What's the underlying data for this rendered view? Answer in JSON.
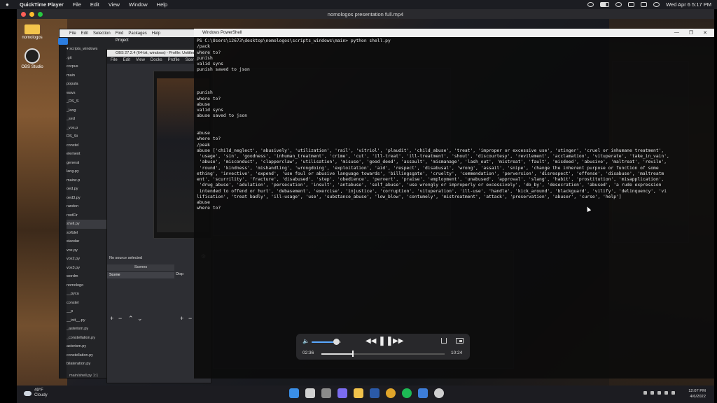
{
  "mac_menubar": {
    "app_name": "QuickTime Player",
    "menus": [
      "File",
      "Edit",
      "View",
      "Window",
      "Help"
    ],
    "datetime": "Wed Apr 6  5:17 PM"
  },
  "qt_window": {
    "title": "nomologos presentation full.mp4"
  },
  "desktop": {
    "icons": [
      {
        "label": "nomologos",
        "icon": "folder-icon"
      },
      {
        "label": "OBS Studio",
        "icon": "obs-icon"
      }
    ]
  },
  "ide": {
    "menus": [
      "File",
      "Edit",
      "Selection",
      "Find",
      "Packages",
      "Help"
    ],
    "project_label": "Project",
    "root": "scripts_windows",
    "tree": [
      "   .git",
      "   corpus",
      "  main",
      "     popula",
      "     wavs",
      "    _DS_S",
      "    _lang",
      "    _sed",
      "    _vox.p",
      "    DS_St",
      "    constel",
      "    element",
      "    general",
      "    lang.py",
      "    mainz.p",
      "    oed.py",
      "    oed3.py",
      "    randon",
      "    rootFir",
      "    shell.py",
      "    softdel",
      "    standar",
      "    vox.py",
      "    vox2.py",
      "    vox3.py",
      "    wordm",
      "  nomologo",
      "     __pyca",
      "    constel",
      "      __p",
      "      __init__.py",
      "      _asterism.py",
      "      _constellation.py",
      "      asterism.py",
      "      constellation.py",
      "      bilateration.py"
    ],
    "selected_index": 19,
    "status": "main/shell.py    1:1"
  },
  "obs": {
    "title": "OBS 27.2.4 (64-bit, windows) - Profile: Untitled - Scenes: Untitled",
    "menus": [
      "File",
      "Edit",
      "View",
      "Docks",
      "Profile",
      "Scene"
    ],
    "no_source": "No source selected",
    "scenes_header": "Scenes",
    "scene_item": "Scene",
    "sources_header": "Disp"
  },
  "powershell": {
    "title": "Windows PowerShell",
    "window_buttons": [
      "—",
      "❐",
      "✕"
    ],
    "lines": [
      "PS C:\\Users\\12673\\desktop\\nomologos\\scripts_windows\\main> python shell.py",
      "/pack",
      "where to?",
      "punish",
      "valid syns",
      "punish saved to json",
      "",
      "",
      "",
      "punish",
      "where to?",
      "abuse",
      "valid syns",
      "abuse saved to json",
      "",
      "",
      "abuse",
      "where to?",
      "/peak",
      "abuse ['child_neglect', 'abusively', 'utilization', 'rail', 'vitriol', 'plaudit', 'child_abuse', 'treat', 'improper or excessive use', 'stinger', 'cruel or inhumane treatment',",
      " 'usage', 'sin', 'goodness', 'inhuman_treatment', 'crime', 'cut', 'ill-treat', 'ill-treatment', 'shout', 'discourtesy', 'revilement', 'acclamation', 'vituperate', 'take_in_vain',",
      " 'abuse', 'misconduct', 'clapperclaw', 'utilisation', 'misuse', 'good_deed', 'assault', 'mismanage', 'lash_out', 'mistreat', 'fault', 'misdeed', 'abusive', 'maltreat', 'revile',",
      " 'round', 'kindness', 'mishandling', 'wrongdoing', 'exploitation', 'aid', 'respect', 'disabusal', 'wrong', 'assail', 'snipe', 'change the inherent purpose or function of some",
      "ething', 'invective', 'expend', 'use foul or abusive language towards', 'billingsgate', 'cruelty', 'commendation', 'perversion', 'disrespect', 'offense', 'disabuse', 'maltreatm",
      "ent', 'scurrility', 'fracture', 'disabused', 'step', 'obedience', 'pervert', 'praise', 'employment', 'unabused', 'approval', 'slang', 'habit', 'prostitution', 'misapplication',",
      " 'drug_abuse', 'adulation', 'persecution', 'insult', 'antabuse', 'self_abuse', 'use wrongly or improperly or excessively', 'do_by', 'desecration', 'abused', 'a rude expression",
      " intended to offend or hurt', 'debasement', 'exercise', 'injustice', 'corruption', 'vituperation', 'ill-use', 'handle', 'kick_around', 'blackguard', 'vilify', 'delinquency', 'vi",
      "lification', 'treat badly', 'ill-usage', 'use', 'substance_abuse', 'low_blow', 'contumely', 'mistreatment', 'attack', 'preservation', 'abuser', 'curse', 'help']",
      "abuse",
      "where to?"
    ]
  },
  "player_hud": {
    "elapsed": "02:36",
    "duration": "10:24",
    "progress": 0.25,
    "volume": 0.85
  },
  "windows_taskbar": {
    "weather_temp": "49°F",
    "weather_text": "Cloudy",
    "time": "12:07 PM",
    "date": "4/6/2022",
    "pinned": [
      {
        "name": "windows-start-icon",
        "color": "#3a8ee6"
      },
      {
        "name": "search-icon",
        "color": "#d0d0d0"
      },
      {
        "name": "task-view-icon",
        "color": "#8a8a8a"
      },
      {
        "name": "chat-icon",
        "color": "#7b6cf0"
      },
      {
        "name": "file-explorer-icon",
        "color": "#f1c24b"
      },
      {
        "name": "terminal-icon",
        "color": "#2b5aa8"
      },
      {
        "name": "chrome-icon",
        "color": "#e0a52a"
      },
      {
        "name": "spotify-icon",
        "color": "#1db954"
      },
      {
        "name": "photos-icon",
        "color": "#3d7dd8"
      },
      {
        "name": "obs-icon",
        "color": "#cfcfcf"
      }
    ]
  }
}
